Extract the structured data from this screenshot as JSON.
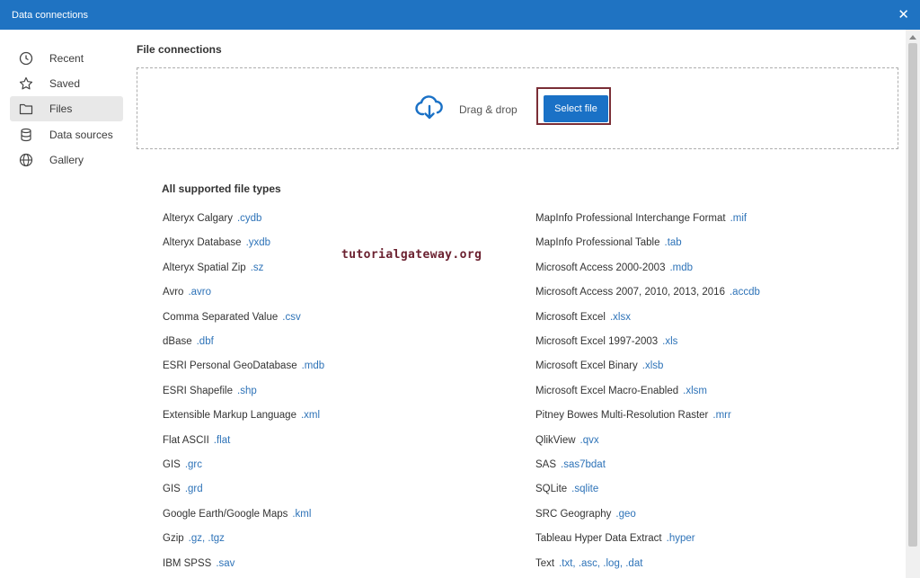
{
  "window": {
    "title": "Data connections"
  },
  "sidebar": {
    "items": [
      {
        "label": "Recent",
        "icon": "clock-icon"
      },
      {
        "label": "Saved",
        "icon": "star-icon"
      },
      {
        "label": "Files",
        "icon": "folder-icon",
        "active": true
      },
      {
        "label": "Data sources",
        "icon": "database-icon"
      },
      {
        "label": "Gallery",
        "icon": "globe-icon"
      }
    ]
  },
  "main": {
    "section_title": "File connections",
    "dropzone": {
      "text": "Drag & drop",
      "button": "Select file",
      "icon": "cloud-download-icon"
    },
    "supported_title": "All supported file types",
    "watermark": "tutorialgateway.org",
    "left_column": [
      {
        "name": "Alteryx Calgary",
        "ext": ".cydb"
      },
      {
        "name": "Alteryx Database",
        "ext": ".yxdb"
      },
      {
        "name": "Alteryx Spatial Zip",
        "ext": ".sz"
      },
      {
        "name": "Avro",
        "ext": ".avro"
      },
      {
        "name": "Comma Separated Value",
        "ext": ".csv"
      },
      {
        "name": "dBase",
        "ext": ".dbf"
      },
      {
        "name": "ESRI Personal GeoDatabase",
        "ext": ".mdb"
      },
      {
        "name": "ESRI Shapefile",
        "ext": ".shp"
      },
      {
        "name": "Extensible Markup Language",
        "ext": ".xml"
      },
      {
        "name": "Flat ASCII",
        "ext": ".flat"
      },
      {
        "name": "GIS",
        "ext": ".grc"
      },
      {
        "name": "GIS",
        "ext": ".grd"
      },
      {
        "name": "Google Earth/Google Maps",
        "ext": ".kml"
      },
      {
        "name": "Gzip",
        "ext": ".gz, .tgz"
      },
      {
        "name": "IBM SPSS",
        "ext": ".sav"
      }
    ],
    "right_column": [
      {
        "name": "MapInfo Professional Interchange Format",
        "ext": ".mif"
      },
      {
        "name": "MapInfo Professional Table",
        "ext": ".tab"
      },
      {
        "name": "Microsoft Access 2000-2003",
        "ext": ".mdb"
      },
      {
        "name": "Microsoft Access 2007, 2010, 2013, 2016",
        "ext": ".accdb"
      },
      {
        "name": "Microsoft Excel",
        "ext": ".xlsx"
      },
      {
        "name": "Microsoft Excel 1997-2003",
        "ext": ".xls"
      },
      {
        "name": "Microsoft Excel Binary",
        "ext": ".xlsb"
      },
      {
        "name": "Microsoft Excel Macro-Enabled",
        "ext": ".xlsm"
      },
      {
        "name": "Pitney Bowes Multi-Resolution Raster",
        "ext": ".mrr"
      },
      {
        "name": "QlikView",
        "ext": ".qvx"
      },
      {
        "name": "SAS",
        "ext": ".sas7bdat"
      },
      {
        "name": "SQLite",
        "ext": ".sqlite"
      },
      {
        "name": "SRC Geography",
        "ext": ".geo"
      },
      {
        "name": "Tableau Hyper Data Extract",
        "ext": ".hyper"
      },
      {
        "name": "Text",
        "ext": ".txt, .asc, .log, .dat"
      }
    ]
  },
  "colors": {
    "titlebar": "#1f73c2",
    "button": "#1a71c6",
    "extension": "#2e73b8",
    "highlight_border": "#7a2e36"
  }
}
